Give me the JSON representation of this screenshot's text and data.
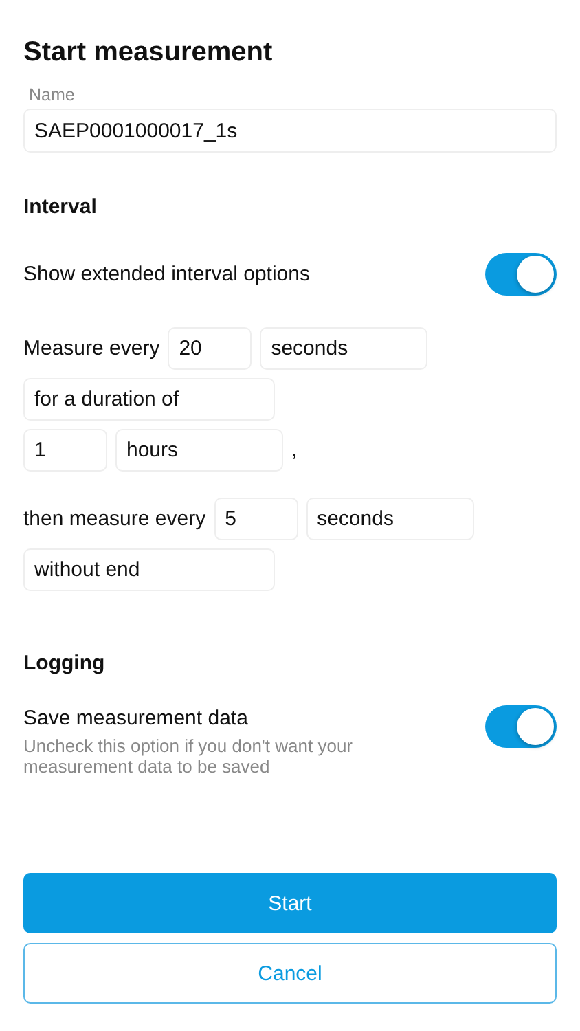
{
  "title": "Start measurement",
  "name_field": {
    "label": "Name",
    "value": "SAEP0001000017_1s"
  },
  "interval": {
    "heading": "Interval",
    "toggle": {
      "label": "Show extended interval options",
      "on": true
    },
    "lines": [
      {
        "parts": [
          {
            "kind": "label",
            "text": "Measure every"
          },
          {
            "kind": "number",
            "text": "20"
          },
          {
            "kind": "select",
            "text": "seconds"
          }
        ]
      },
      {
        "parts": [
          {
            "kind": "phrase",
            "text": "for a duration of"
          }
        ]
      },
      {
        "parts": [
          {
            "kind": "number",
            "text": "1"
          },
          {
            "kind": "select",
            "text": "hours"
          },
          {
            "kind": "label",
            "text": ","
          }
        ]
      },
      {
        "parts": [
          {
            "kind": "label",
            "text": "then measure every"
          },
          {
            "kind": "number",
            "text": "5"
          },
          {
            "kind": "select",
            "text": "seconds"
          }
        ]
      },
      {
        "parts": [
          {
            "kind": "phrase",
            "text": "without end"
          }
        ]
      }
    ]
  },
  "logging": {
    "heading": "Logging",
    "toggle": {
      "label": "Save measurement data",
      "hint": "Uncheck this option if you don't want your measurement data to be saved",
      "on": true
    }
  },
  "buttons": [
    {
      "kind": "primary",
      "label": "Start"
    },
    {
      "kind": "secondary",
      "label": "Cancel"
    }
  ]
}
